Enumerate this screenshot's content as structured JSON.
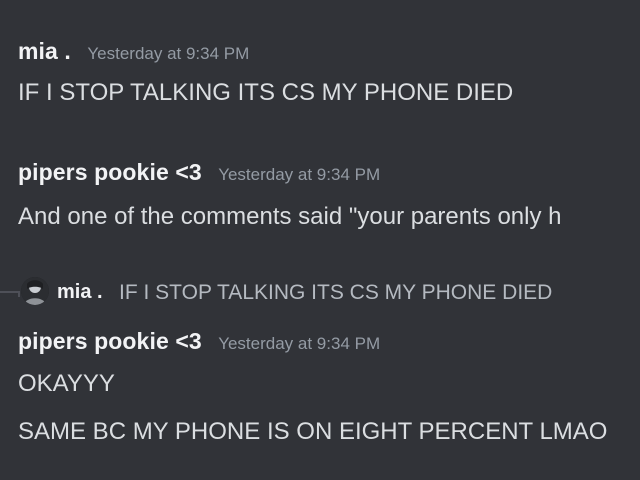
{
  "messages": [
    {
      "author": "mia .",
      "timestamp": "Yesterday at 9:34 PM",
      "lines": [
        "IF I STOP TALKING ITS CS MY PHONE DIED"
      ]
    },
    {
      "author": "pipers pookie <3",
      "timestamp": "Yesterday at 9:34 PM",
      "lines": [
        "And one of the comments said \"your parents only h"
      ]
    },
    {
      "reply": {
        "author": "mia .",
        "text": "IF I STOP TALKING ITS CS MY PHONE DIED"
      },
      "author": "pipers pookie <3",
      "timestamp": "Yesterday at 9:34 PM",
      "lines": [
        "OKAYYY",
        "SAME BC MY PHONE IS ON EIGHT PERCENT LMAO"
      ]
    }
  ],
  "colors": {
    "background": "#313338",
    "author": "#f2f3f5",
    "text": "#dbdee1",
    "timestamp": "#949ba4",
    "reply_text": "#b5bac1"
  },
  "icons": {
    "reply_avatar": "user-avatar-icon",
    "reply_connector": "reply-spine"
  }
}
